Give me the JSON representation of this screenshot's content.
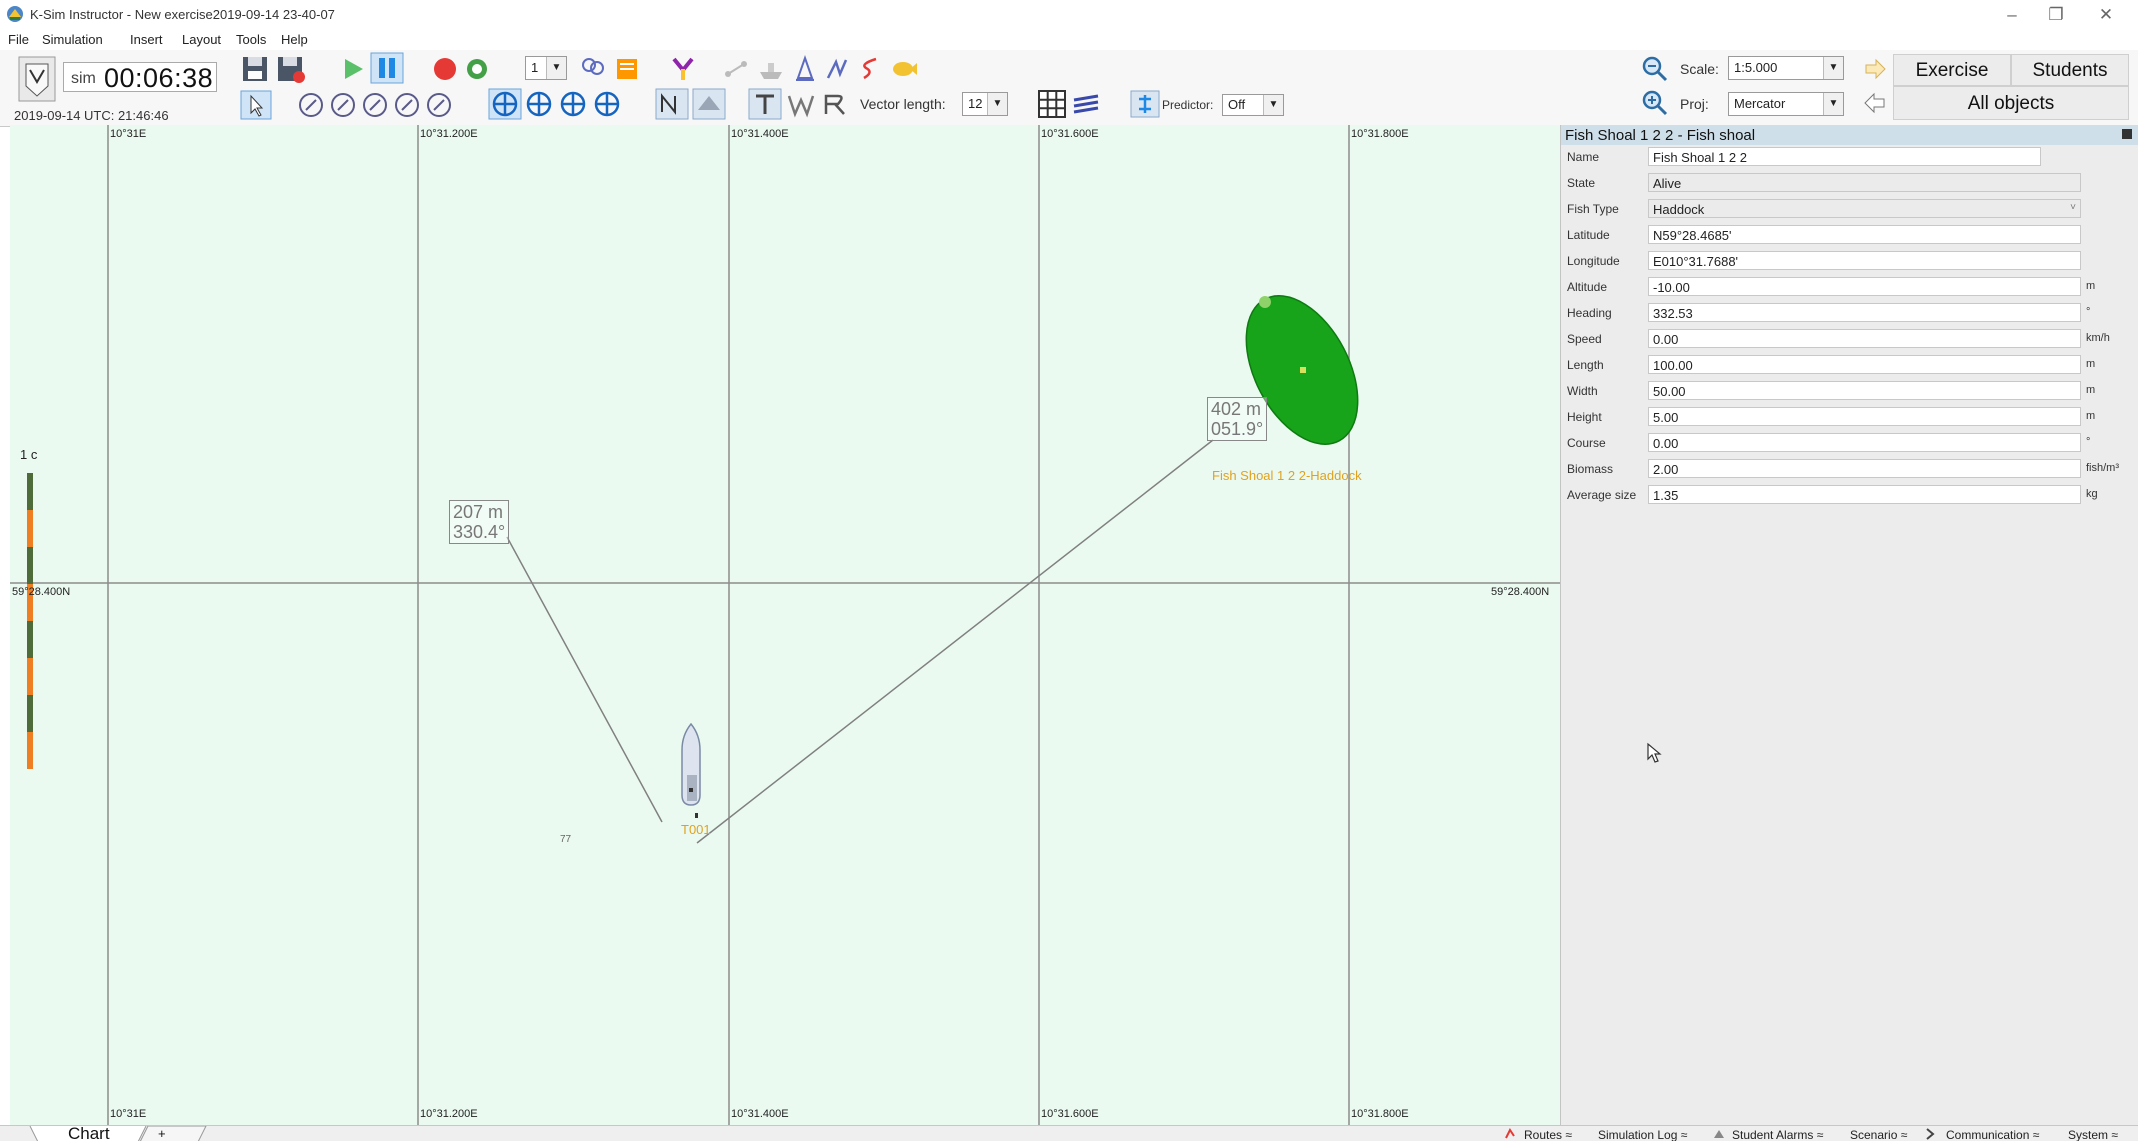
{
  "window": {
    "title": "K-Sim Instructor - New exercise2019-09-14 23-40-07",
    "minimize": "–",
    "maximize": "❐",
    "close": "✕"
  },
  "menu": [
    "File",
    "Simulation",
    "Insert",
    "Layout",
    "Tools",
    "Help"
  ],
  "toolbar": {
    "sim_label": "sim",
    "sim_time": "00:06:38",
    "date": "2019-09-14",
    "utc": "UTC: 21:46:46",
    "speed_value": "1",
    "vector_length_label": "Vector length:",
    "vector_length_value": "12",
    "predictor_label": "Predictor:",
    "predictor_value": "Off",
    "scale_label": "Scale:",
    "scale_value": "1:5.000",
    "proj_label": "Proj:",
    "proj_value": "Mercator",
    "exercise_tab": "Exercise",
    "students_tab": "Students",
    "all_objects_tab": "All objects"
  },
  "chart": {
    "lon_labels": [
      "10°31E",
      "10°31.200E",
      "10°31.400E",
      "10°31.600E",
      "10°31.800E"
    ],
    "lat_label": "59°28.400N",
    "scale_bar_label": "1 c",
    "measure1_distance": "207 m",
    "measure1_bearing": "330.4°",
    "measure2_distance": "402 m",
    "measure2_bearing": "051.9°",
    "shoal_label": "Fish Shoal 1 2 2-Haddock",
    "ship_label": "T001",
    "misc_label": "77",
    "colors": {
      "water": "#ebfaf1",
      "shoal": "#17a31a",
      "label": "#e0a21e",
      "grid": "#8c8c8c"
    }
  },
  "properties": {
    "title": "Fish Shoal 1 2 2 - Fish shoal",
    "rows": [
      {
        "label": "Name",
        "value": "Fish Shoal 1 2 2",
        "unit": ""
      },
      {
        "label": "State",
        "value": "Alive",
        "unit": ""
      },
      {
        "label": "Fish Type",
        "value": "Haddock",
        "unit": ""
      },
      {
        "label": "Latitude",
        "value": "N59°28.4685'",
        "unit": ""
      },
      {
        "label": "Longitude",
        "value": "E010°31.7688'",
        "unit": ""
      },
      {
        "label": "Altitude",
        "value": "-10.00",
        "unit": "m"
      },
      {
        "label": "Heading",
        "value": "332.53",
        "unit": "°"
      },
      {
        "label": "Speed",
        "value": "0.00",
        "unit": "km/h"
      },
      {
        "label": "Length",
        "value": "100.00",
        "unit": "m"
      },
      {
        "label": "Width",
        "value": "50.00",
        "unit": "m"
      },
      {
        "label": "Height",
        "value": "5.00",
        "unit": "m"
      },
      {
        "label": "Course",
        "value": "0.00",
        "unit": "°"
      },
      {
        "label": "Biomass",
        "value": "2.00",
        "unit": "fish/m³"
      },
      {
        "label": "Average size",
        "value": "1.35",
        "unit": "kg"
      }
    ]
  },
  "bottom": {
    "chart_tab": "Chart",
    "add_tab": "+",
    "status_items": [
      "Routes ≈",
      "Simulation Log ≈",
      "Student Alarms ≈",
      "Scenario ≈",
      "Communication ≈",
      "System ≈"
    ]
  }
}
